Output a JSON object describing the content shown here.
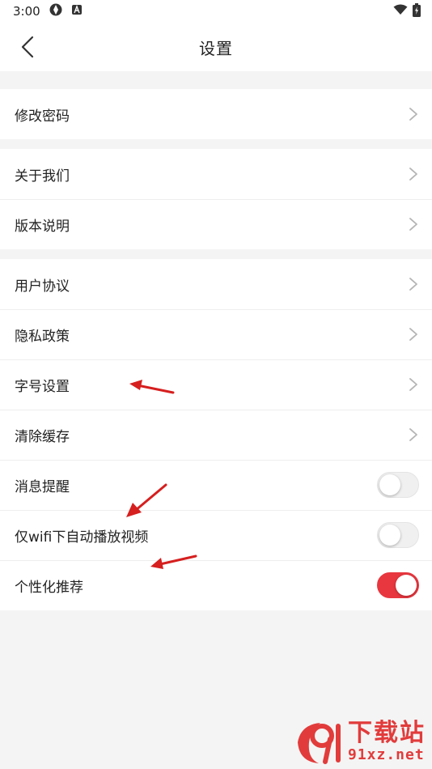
{
  "status_bar": {
    "time": "3:00"
  },
  "header": {
    "title": "设置"
  },
  "groups": [
    {
      "items": [
        {
          "label": "修改密码",
          "type": "link"
        }
      ]
    },
    {
      "items": [
        {
          "label": "关于我们",
          "type": "link"
        },
        {
          "label": "版本说明",
          "type": "link"
        }
      ]
    },
    {
      "items": [
        {
          "label": "用户协议",
          "type": "link"
        },
        {
          "label": "隐私政策",
          "type": "link"
        },
        {
          "label": "字号设置",
          "type": "link"
        },
        {
          "label": "清除缓存",
          "type": "link"
        },
        {
          "label": "消息提醒",
          "type": "toggle",
          "on": false
        },
        {
          "label": "仅wifi下自动播放视频",
          "type": "toggle",
          "on": false
        },
        {
          "label": "个性化推荐",
          "type": "toggle",
          "on": true
        }
      ]
    }
  ],
  "colors": {
    "accent": "#e8373f",
    "annotation": "#d61f1f",
    "background": "#f4f4f4"
  },
  "watermark": {
    "text": "下载站",
    "url": "91xz.net"
  }
}
